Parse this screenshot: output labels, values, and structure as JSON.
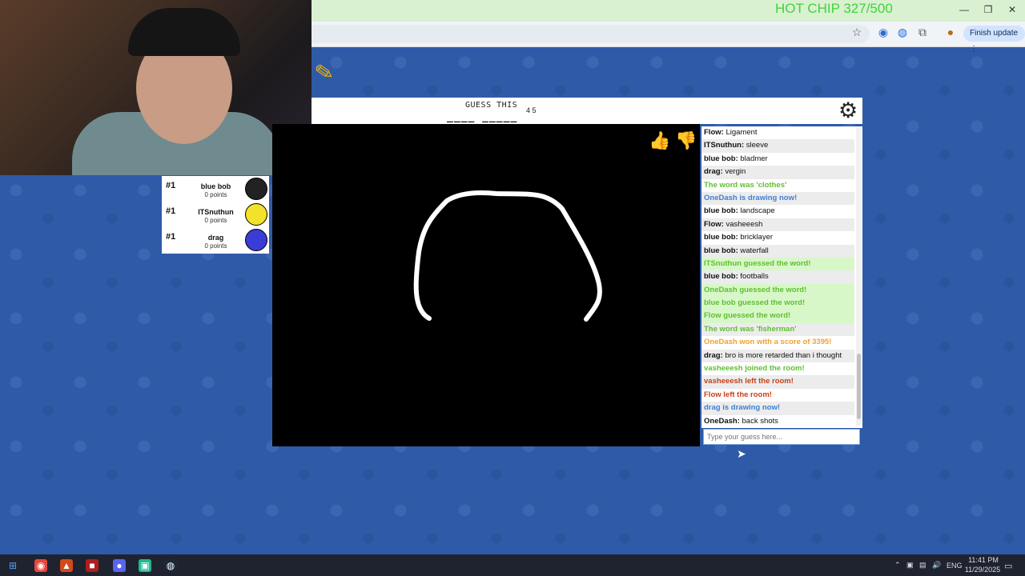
{
  "browser": {
    "overlay_text": "HOT CHIP 327/500",
    "finish_update_label": "Finish update",
    "window_controls": [
      "—",
      "❐",
      "✕"
    ]
  },
  "header": {
    "guess_label": "GUESS THIS",
    "word_pattern": "____ _____",
    "word_lengths": "4 5"
  },
  "players": [
    {
      "rank": "#1",
      "name": "blue bob",
      "points": "0 points",
      "avatar_color": "#222222"
    },
    {
      "rank": "#1",
      "name": "ITSnuthun",
      "points": "0 points",
      "avatar_color": "#f2e229"
    },
    {
      "rank": "#1",
      "name": "drag",
      "points": "0 points",
      "avatar_color": "#3b3bd6"
    }
  ],
  "chat": {
    "messages": [
      {
        "user": "Flow:",
        "text": "Ligament",
        "color": "#111111"
      },
      {
        "user": "ITSnuthun:",
        "text": "sleeve",
        "color": "#111111"
      },
      {
        "user": "blue bob:",
        "text": "bladmer",
        "color": "#111111"
      },
      {
        "user": "drag:",
        "text": "vergin",
        "color": "#111111"
      },
      {
        "user": "",
        "text": "The word was 'clothes'",
        "color": "#5fbf2f"
      },
      {
        "user": "",
        "text": "OneDash is drawing now!",
        "color": "#3f7fd1"
      },
      {
        "user": "blue bob:",
        "text": "landscape",
        "color": "#111111"
      },
      {
        "user": "Flow:",
        "text": "vasheeesh",
        "color": "#111111"
      },
      {
        "user": "blue bob:",
        "text": "bricklayer",
        "color": "#111111"
      },
      {
        "user": "blue bob:",
        "text": "waterfall",
        "color": "#111111"
      },
      {
        "user": "",
        "text": "ITSnuthun guessed the word!",
        "color": "#5fbf2f",
        "bg": "#d8f7c9"
      },
      {
        "user": "blue bob:",
        "text": "footballs",
        "color": "#111111"
      },
      {
        "user": "",
        "text": "OneDash guessed the word!",
        "color": "#5fbf2f",
        "bg": "#d8f7c9"
      },
      {
        "user": "",
        "text": "blue bob guessed the word!",
        "color": "#5fbf2f",
        "bg": "#d8f7c9"
      },
      {
        "user": "",
        "text": "Flow guessed the word!",
        "color": "#5fbf2f",
        "bg": "#d8f7c9"
      },
      {
        "user": "",
        "text": "The word was 'fisherman'",
        "color": "#5fbf2f"
      },
      {
        "user": "",
        "text": "OneDash won with a score of 3395!",
        "color": "#f0a030"
      },
      {
        "user": "drag:",
        "text": "bro is more retarded than i thought",
        "color": "#111111"
      },
      {
        "user": "",
        "text": "vasheeesh joined the room!",
        "color": "#5fbf2f"
      },
      {
        "user": "",
        "text": "vasheeesh left the room!",
        "color": "#c7401a"
      },
      {
        "user": "",
        "text": "Flow left the room!",
        "color": "#c7401a"
      },
      {
        "user": "",
        "text": "drag is drawing now!",
        "color": "#3f7fd1"
      },
      {
        "user": "OneDash:",
        "text": "back shots",
        "color": "#111111"
      }
    ],
    "input_placeholder": "Type your guess here..."
  },
  "taskbar": {
    "language": "ENG",
    "time": "11:41 PM",
    "date": "11/29/2025"
  }
}
